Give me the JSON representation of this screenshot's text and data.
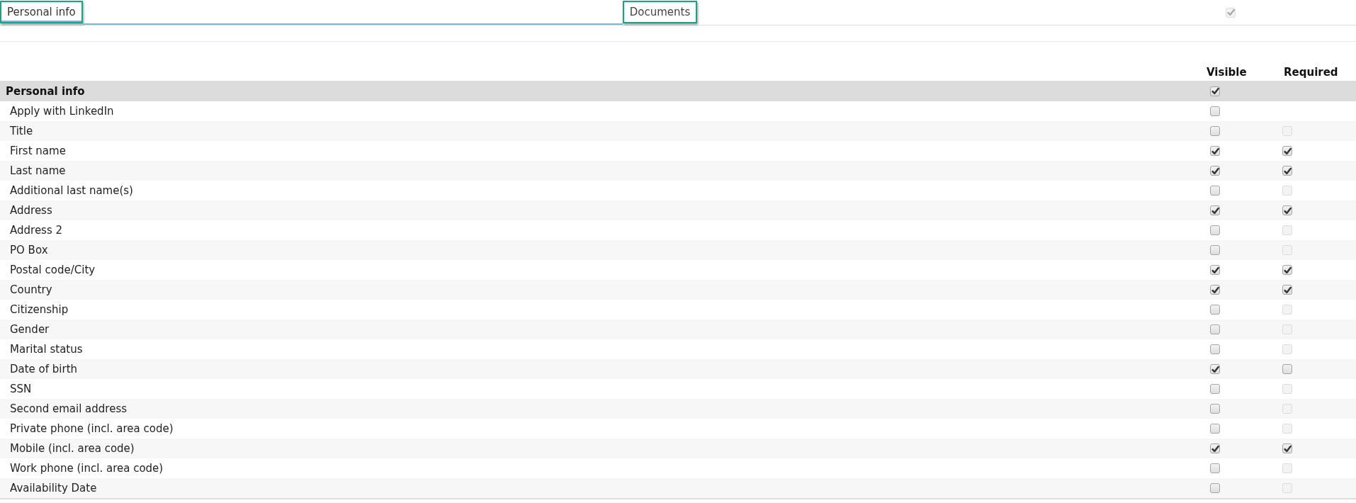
{
  "tabs": [
    {
      "label": "Personal info",
      "selected": true
    },
    {
      "label": "Documents",
      "selected": false
    }
  ],
  "tab_bar_checkbox": {
    "checked": true,
    "disabled": true
  },
  "table": {
    "columns": [
      "Visible",
      "Required"
    ],
    "section": {
      "title": "Personal info",
      "visible": true
    },
    "rows": [
      {
        "label": "Apply with LinkedIn",
        "visible": false
      },
      {
        "label": "Title",
        "visible": false,
        "required": false,
        "required_disabled": true
      },
      {
        "label": "First name",
        "visible": true,
        "required": true,
        "required_disabled": false
      },
      {
        "label": "Last name",
        "visible": true,
        "required": true,
        "required_disabled": false
      },
      {
        "label": "Additional last name(s)",
        "visible": false,
        "required": false,
        "required_disabled": true
      },
      {
        "label": "Address",
        "visible": true,
        "required": true,
        "required_disabled": false
      },
      {
        "label": "Address 2",
        "visible": false,
        "required": false,
        "required_disabled": true
      },
      {
        "label": "PO Box",
        "visible": false,
        "required": false,
        "required_disabled": true
      },
      {
        "label": "Postal code/City",
        "visible": true,
        "required": true,
        "required_disabled": false
      },
      {
        "label": "Country",
        "visible": true,
        "required": true,
        "required_disabled": false
      },
      {
        "label": "Citizenship",
        "visible": false,
        "required": false,
        "required_disabled": true
      },
      {
        "label": "Gender",
        "visible": false,
        "required": false,
        "required_disabled": true
      },
      {
        "label": "Marital status",
        "visible": false,
        "required": false,
        "required_disabled": true
      },
      {
        "label": "Date of birth",
        "visible": true,
        "required": false,
        "required_disabled": false
      },
      {
        "label": "SSN",
        "visible": false,
        "required": false,
        "required_disabled": true
      },
      {
        "label": "Second email address",
        "visible": false,
        "required": false,
        "required_disabled": true
      },
      {
        "label": "Private phone (incl. area code)",
        "visible": false,
        "required": false,
        "required_disabled": true
      },
      {
        "label": "Mobile (incl. area code)",
        "visible": true,
        "required": true,
        "required_disabled": false
      },
      {
        "label": "Work phone (incl. area code)",
        "visible": false,
        "required": false,
        "required_disabled": true
      },
      {
        "label": "Availability Date",
        "visible": false,
        "required": false,
        "required_disabled": true
      }
    ]
  }
}
